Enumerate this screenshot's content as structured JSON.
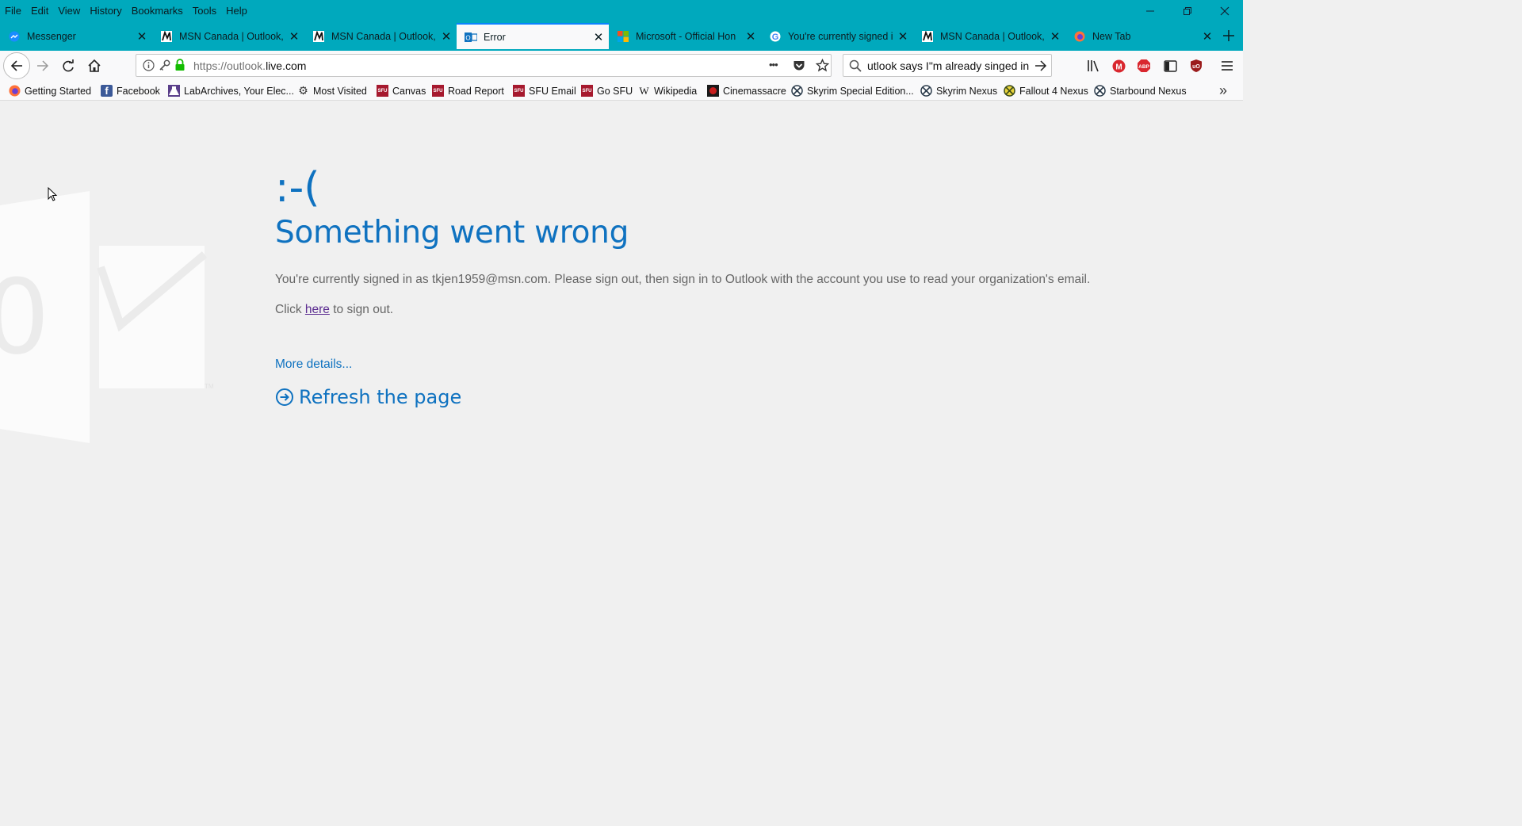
{
  "menu": [
    "File",
    "Edit",
    "View",
    "History",
    "Bookmarks",
    "Tools",
    "Help"
  ],
  "window_controls": {
    "minimize_glyph": "—",
    "restore_glyph": "❐",
    "close_glyph": "✕"
  },
  "tabs": [
    {
      "title": "Messenger",
      "favicon": "messenger-icon"
    },
    {
      "title": "MSN Canada | Outlook,",
      "favicon": "msn-icon"
    },
    {
      "title": "MSN Canada | Outlook,",
      "favicon": "msn-icon"
    },
    {
      "title": "Error",
      "favicon": "outlook-icon",
      "active": true
    },
    {
      "title": "Microsoft - Official Hon",
      "favicon": "microsoft-icon"
    },
    {
      "title": "You're currently signed i",
      "favicon": "google-icon"
    },
    {
      "title": "MSN Canada | Outlook,",
      "favicon": "msn-icon"
    },
    {
      "title": "New Tab",
      "favicon": "firefox-icon"
    }
  ],
  "tab_close_glyph": "✕",
  "new_tab_glyph": "+",
  "url": {
    "prefix": "https://outlook.",
    "domain": "live.com"
  },
  "url_more_glyph": "•••",
  "search": {
    "value": "utlook says I\"m already singed in"
  },
  "bookmarks": [
    {
      "label": "Getting Started",
      "icon": "firefox-icon"
    },
    {
      "label": "Facebook",
      "icon": "facebook-icon",
      "glyph": "f"
    },
    {
      "label": "LabArchives, Your Elec...",
      "icon": "labarchives-icon"
    },
    {
      "label": "Most Visited",
      "icon": "gear-icon",
      "glyph": "⚙"
    },
    {
      "label": "Canvas",
      "icon": "sfu-icon",
      "glyph": "SFU"
    },
    {
      "label": "Road Report",
      "icon": "sfu-icon",
      "glyph": "SFU"
    },
    {
      "label": "SFU Email",
      "icon": "sfu-icon",
      "glyph": "SFU"
    },
    {
      "label": "Go SFU",
      "icon": "sfu-icon",
      "glyph": "SFU"
    },
    {
      "label": "Wikipedia",
      "icon": "wikipedia-icon",
      "glyph": "W"
    },
    {
      "label": "Cinemassacre",
      "icon": "cinemassacre-icon"
    },
    {
      "label": "Skyrim Special Edition...",
      "icon": "nexus-icon"
    },
    {
      "label": "Skyrim Nexus",
      "icon": "nexus-icon"
    },
    {
      "label": "Fallout 4 Nexus",
      "icon": "nexus-icon"
    },
    {
      "label": "Starbound Nexus",
      "icon": "nexus-icon"
    }
  ],
  "bookmarks_overflow_glyph": "»",
  "page": {
    "sad_face": ":-(",
    "heading": "Something went wrong",
    "message": "You're currently signed in as tkjen1959@msn.com. Please sign out, then sign in to Outlook with the account you use to read your organization's email.",
    "click_prefix": "Click ",
    "click_link": "here",
    "click_suffix": " to sign out.",
    "more_details": "More details...",
    "refresh": "Refresh the page"
  },
  "colors": {
    "accent": "#0f72c0",
    "toolbar": "#00a9bd",
    "link_visited": "#5c2d91"
  }
}
